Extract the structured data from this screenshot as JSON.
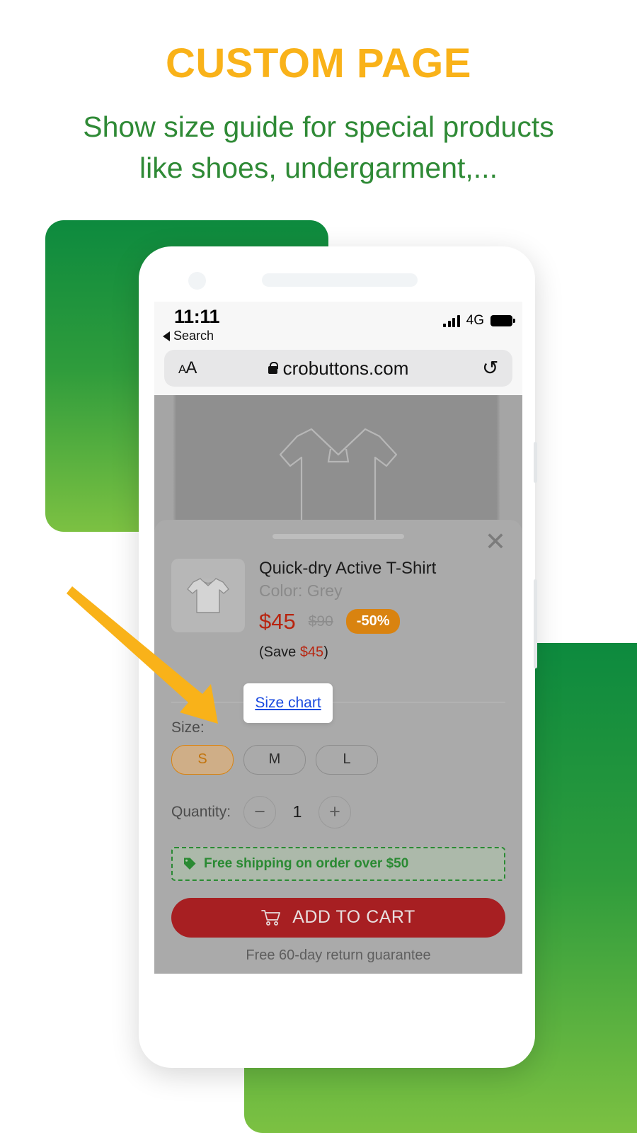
{
  "promo": {
    "headline": "CUSTOM PAGE",
    "subhead_line1": "Show size guide for special products",
    "subhead_line2": "like shoes, undergarment,...",
    "headline_color": "#f9b219",
    "subhead_color": "#2f8a36",
    "accent_green": "#0d8a3e"
  },
  "phone": {
    "status_bar": {
      "time": "11:11",
      "back_label": "Search",
      "network": "4G",
      "signal_icon": "signal-bars-icon",
      "battery_icon": "battery-full-icon"
    },
    "browser": {
      "text_size_button": "AA",
      "lock_icon": "lock-icon",
      "url": "crobuttons.com",
      "reload_icon": "reload-icon"
    },
    "hero": {
      "image_alt": "polo-shirt-outline"
    },
    "sheet": {
      "close_icon": "close-icon",
      "grabber_icon": "drag-handle-icon",
      "product": {
        "thumbnail_alt": "t-shirt-thumbnail",
        "title": "Quick-dry Active T-Shirt",
        "color_line": "Color: Grey",
        "price_current": "$45",
        "price_original": "$90",
        "discount_badge": "-50%",
        "save_prefix": "(Save ",
        "save_amount": "$45",
        "save_suffix": ")"
      },
      "size_chart": {
        "link_label": "Size chart",
        "link_color": "#1a4ae0"
      },
      "size": {
        "label": "Size:",
        "options": [
          "S",
          "M",
          "L"
        ],
        "selected": "S",
        "selected_color": "#d98310"
      },
      "quantity": {
        "label": "Quantity:",
        "decrement_icon": "minus-icon",
        "increment_icon": "plus-icon",
        "value": "1"
      },
      "shipping_banner": {
        "tag_icon": "price-tag-icon",
        "text": "Free shipping on order over $50",
        "color": "#2a8a33"
      },
      "cta": {
        "cart_icon": "shopping-cart-icon",
        "label": "ADD TO CART",
        "color": "#a71f22"
      },
      "guarantee": "Free 60-day return guarantee"
    }
  },
  "annotation": {
    "arrow_icon": "pointer-arrow-icon",
    "arrow_color": "#f9b219"
  }
}
